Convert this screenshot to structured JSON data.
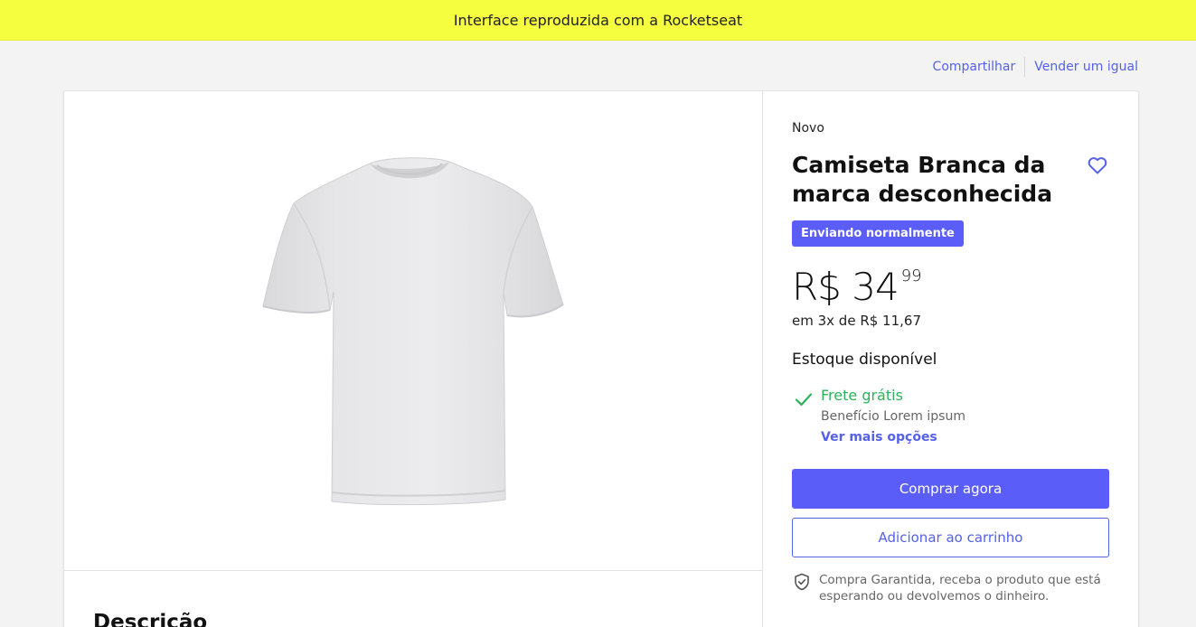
{
  "banner": {
    "text": "Interface reproduzida com a Rocketseat"
  },
  "top_links": {
    "share": "Compartilhar",
    "sell": "Vender um igual"
  },
  "product": {
    "condition": "Novo",
    "title": "Camiseta Branca da marca desconhecida",
    "badge": "Enviando normalmente",
    "price_main": "R$ 34",
    "price_cents": "99",
    "installments": "em 3x de R$ 11,67",
    "stock": "Estoque disponível"
  },
  "shipping": {
    "title": "Frete grátis",
    "subtitle": "Benefício Lorem ipsum",
    "more_link": "Ver mais opções"
  },
  "actions": {
    "buy_label": "Comprar agora",
    "cart_label": "Adicionar ao carrinho"
  },
  "guarantee": {
    "text": "Compra Garantida, receba o produto que está esperando ou devolvemos o dinheiro."
  },
  "description": {
    "title": "Descrição"
  },
  "colors": {
    "banner": "#f5ff40",
    "accent": "#5a5df7",
    "link": "#5561e8",
    "success": "#2bb25a"
  },
  "icons": {
    "favorite": "heart-icon",
    "shipping": "check-icon",
    "guarantee": "shield-check-icon",
    "product_image": "white-tshirt"
  }
}
